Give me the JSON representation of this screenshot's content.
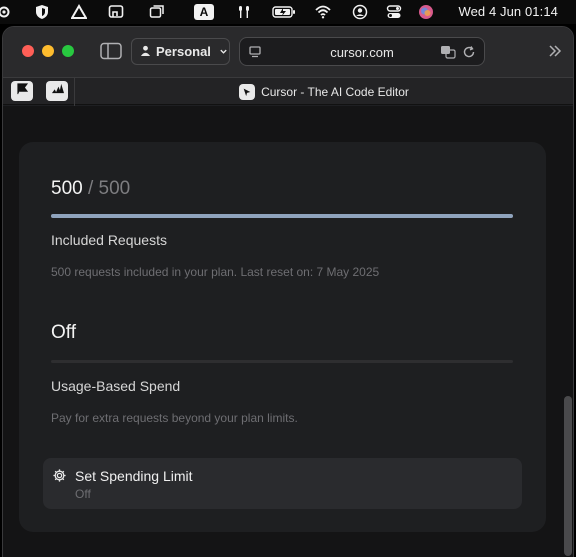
{
  "menubar": {
    "clock": "Wed 4 Jun  01:14",
    "icons": [
      "gear-icon",
      "shield-icon",
      "delta-icon",
      "screen-mirror-icon",
      "windows-icon",
      "keyboard-input-icon",
      "airpods-icon",
      "battery-icon",
      "wifi-icon",
      "user-account-icon",
      "control-center-icon",
      "siri-icon"
    ],
    "input_source_letter": "A"
  },
  "browser": {
    "profile_label": "Personal",
    "url": "cursor.com",
    "tab_title": "Cursor - The AI Code Editor"
  },
  "usage": {
    "used": "500",
    "separator": "/",
    "total": "500",
    "fill_fraction": 1.0,
    "included_title": "Included Requests",
    "included_desc": "500 requests included in your plan. Last reset on: 7 May 2025",
    "spend_value": "Off",
    "spend_title": "Usage-Based Spend",
    "spend_desc": "Pay for extra requests beyond your plan limits.",
    "limit_button_label": "Set Spending Limit",
    "limit_button_status": "Off"
  },
  "colors": {
    "bar_fill": "#8fa3bd",
    "card_bg": "#1e1f21",
    "page_bg": "#141415"
  }
}
